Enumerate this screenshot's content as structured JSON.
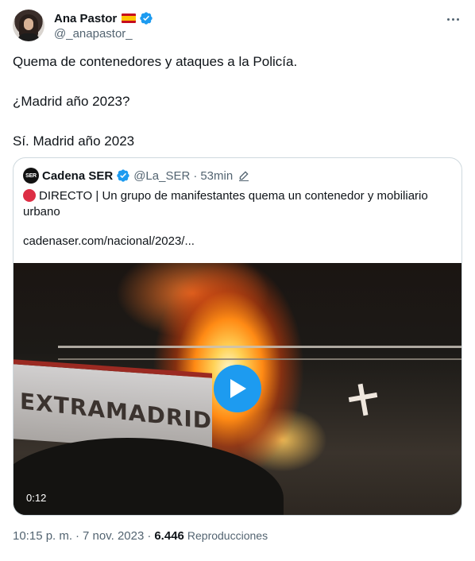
{
  "author": {
    "display_name": "Ana Pastor",
    "handle": "@_anapastor_",
    "flag_icon": "spain-flag-icon",
    "verified_color": "#1d9bf0"
  },
  "tweet": {
    "lines": [
      "Quema de contenedores y ataques a la Policía.",
      "¿Madrid año 2023?",
      "Sí. Madrid año 2023"
    ]
  },
  "quote": {
    "logo_text": "SER",
    "name": "Cadena SER",
    "handle": "@La_SER",
    "separator": "·",
    "time": "53min",
    "text": "DIRECTO | Un grupo de manifestantes quema un contenedor y mobiliario urbano",
    "link": "cadenaser.com/nacional/2023/...",
    "video": {
      "overlay_text": "EXTRAMADRID",
      "duration": "0:12"
    }
  },
  "footer": {
    "time": "10:15 p. m.",
    "separator": "·",
    "date": "7 nov. 2023",
    "separator2": "·",
    "views_count": "6.446",
    "views_label": "Reproducciones"
  },
  "colors": {
    "accent": "#1d9bf0",
    "text_primary": "#0f1419",
    "text_secondary": "#536471",
    "border": "#cfd9de",
    "live_dot": "#dd2e44"
  }
}
